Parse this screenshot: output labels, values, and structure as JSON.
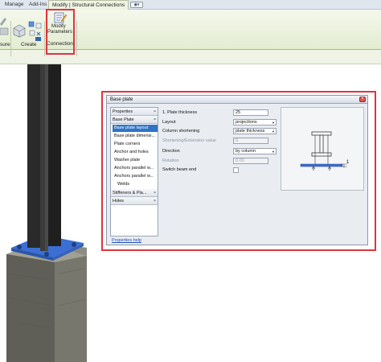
{
  "ribbon": {
    "tabs": [
      {
        "label": "Manage"
      },
      {
        "label": "Add-Ins"
      },
      {
        "label": "Modify | Structural Connections"
      }
    ],
    "left_partial_label": "sure",
    "create_label": "Create",
    "modify_button_label_line1": "Modify",
    "modify_button_label_line2": "Parameters",
    "panel_label": "Connection"
  },
  "dialog": {
    "title": "Base plate",
    "tree": {
      "headers": [
        {
          "label": "Properties",
          "chevron": "≈"
        },
        {
          "label": "Base Plate",
          "chevron": "≈"
        },
        {
          "label": "Stiffeners & Pla...",
          "chevron": "≈"
        },
        {
          "label": "Holes",
          "chevron": "≈"
        }
      ],
      "items": [
        {
          "label": "Base plate layout"
        },
        {
          "label": "Base plate dimensi..."
        },
        {
          "label": "Plate corners"
        },
        {
          "label": "Anchor and holes"
        },
        {
          "label": "Washer plate"
        },
        {
          "label": "Anchors parallel w..."
        },
        {
          "label": "Anchors parallel w..."
        },
        {
          "label": "Welds"
        }
      ]
    },
    "fields": {
      "plate_thickness_label": "1. Plate thickness",
      "plate_thickness_value": "25",
      "layout_label": "Layout",
      "layout_value": "projections",
      "column_shortening_label": "Column shortening",
      "column_shortening_value": "plate thickness",
      "shortening_ext_label": "Shortening/Extension value",
      "shortening_ext_value": "0",
      "direction_label": "Direction",
      "direction_value": "by column",
      "rotation_label": "Rotation",
      "rotation_value": "0.00",
      "switch_beam_end_label": "Switch beam end",
      "switch_beam_end_checked": false
    },
    "preview_label": "1",
    "help_link": "Properties help"
  },
  "colors": {
    "highlight": "#e0343c",
    "selection": "#2f73c6",
    "steel": "#2a2a2a",
    "plate": "#3b6fd4",
    "concrete": "#6f6f66"
  },
  "icons": [
    "modify-parameters-icon",
    "create-icon",
    "measure-icon",
    "close-icon",
    "chevron-icon",
    "dropdown-arrow-icon",
    "checkbox-icon"
  ]
}
